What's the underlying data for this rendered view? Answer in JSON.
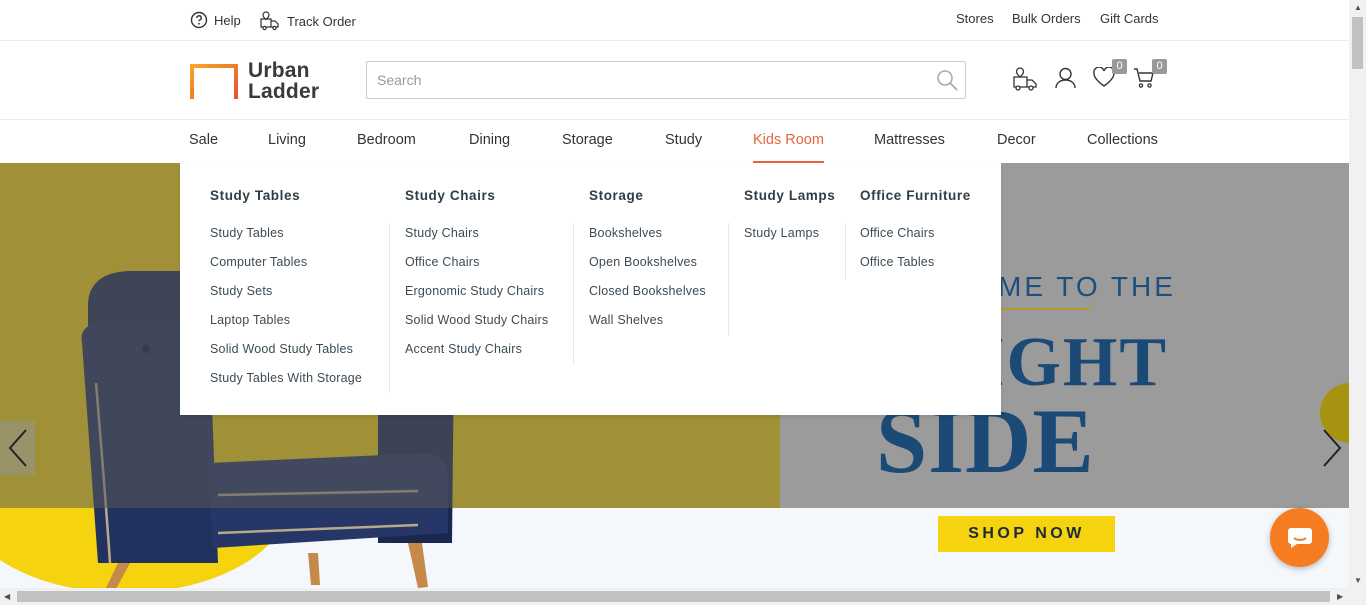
{
  "topbar": {
    "help": "Help",
    "track_order": "Track Order",
    "stores": "Stores",
    "bulk_orders": "Bulk Orders",
    "gift_cards": "Gift Cards"
  },
  "header": {
    "logo_line1": "Urban",
    "logo_line2": "Ladder",
    "search_placeholder": "Search",
    "wishlist_count": "0",
    "cart_count": "0",
    "accent_color": "#e8653c"
  },
  "nav": {
    "items": [
      "Sale",
      "Living",
      "Bedroom",
      "Dining",
      "Storage",
      "Study",
      "Kids Room",
      "Mattresses",
      "Decor",
      "Collections"
    ],
    "active": "Kids Room"
  },
  "mega_menu": {
    "columns": [
      {
        "title": "Study Tables",
        "links": [
          "Study Tables",
          "Computer Tables",
          "Study Sets",
          "Laptop Tables",
          "Solid Wood Study Tables",
          "Study Tables With Storage"
        ]
      },
      {
        "title": "Study Chairs",
        "links": [
          "Study Chairs",
          "Office Chairs",
          "Ergonomic Study Chairs",
          "Solid Wood Study Chairs",
          "Accent Study Chairs"
        ]
      },
      {
        "title": "Storage",
        "links": [
          "Bookshelves",
          "Open Bookshelves",
          "Closed Bookshelves",
          "Wall Shelves"
        ]
      },
      {
        "title": "Study Lamps",
        "links": [
          "Study Lamps"
        ]
      },
      {
        "title": "Office Furniture",
        "links": [
          "Office Chairs",
          "Office Tables"
        ]
      }
    ]
  },
  "hero": {
    "tagline": "ME TO THE",
    "big1": "BRIGHT",
    "big2": "SIDE",
    "cta": "SHOP NOW"
  }
}
